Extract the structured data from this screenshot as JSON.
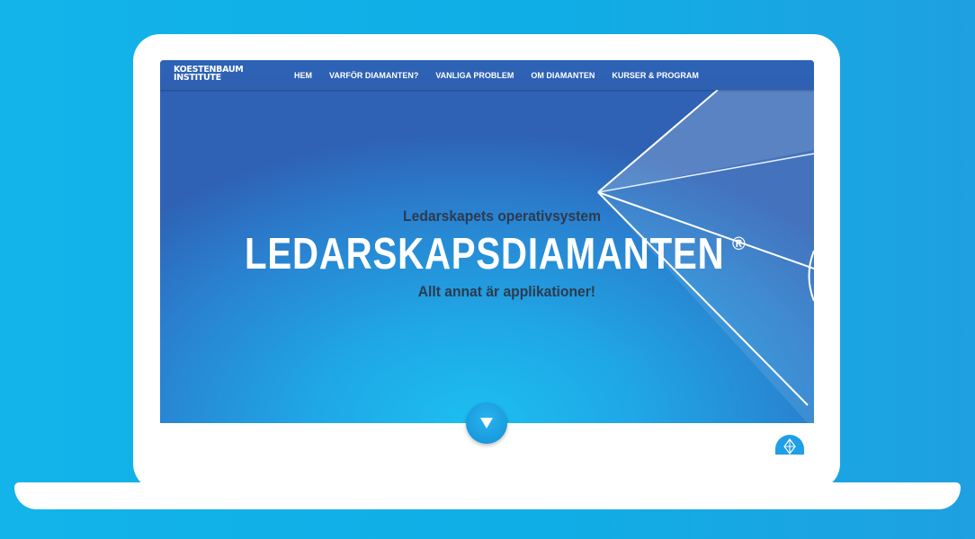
{
  "site": {
    "logo": {
      "line1": "KOESTENBAUM",
      "line2": "INSTITUTE"
    },
    "nav": [
      {
        "label": "HEM"
      },
      {
        "label": "VARFÖR DIAMANTEN?"
      },
      {
        "label": "VANLIGA PROBLEM"
      },
      {
        "label": "OM DIAMANTEN"
      },
      {
        "label": "KURSER & PROGRAM"
      }
    ]
  },
  "hero": {
    "tagline": "Ledarskapets operativsystem",
    "title": "LEDARSKAPSDIAMANTEN",
    "registered": "®",
    "subtitle": "Allt annat är applikationer!"
  },
  "icons": {
    "scroll_down": "down-arrow-icon",
    "chat": "diamond-icon"
  },
  "colors": {
    "background": "#12b4ea",
    "navbar": "#2f60b2",
    "hero_top": "#2f62b5",
    "hero_glow": "#1cbff0",
    "tagline_text": "#2d3a4f",
    "title_text": "#ffffff"
  }
}
